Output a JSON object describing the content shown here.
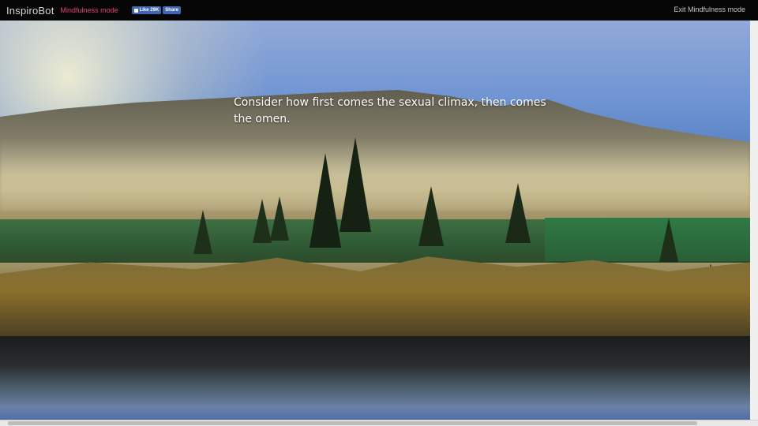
{
  "header": {
    "brand": "InspiroBot",
    "mode_label": "Mindfulness mode",
    "facebook_like_label": "Like 29K",
    "facebook_share_label": "Share",
    "exit_label": "Exit Mindfulness mode"
  },
  "quote": {
    "text": "Consider how first comes the sexual climax, then comes the omen."
  }
}
